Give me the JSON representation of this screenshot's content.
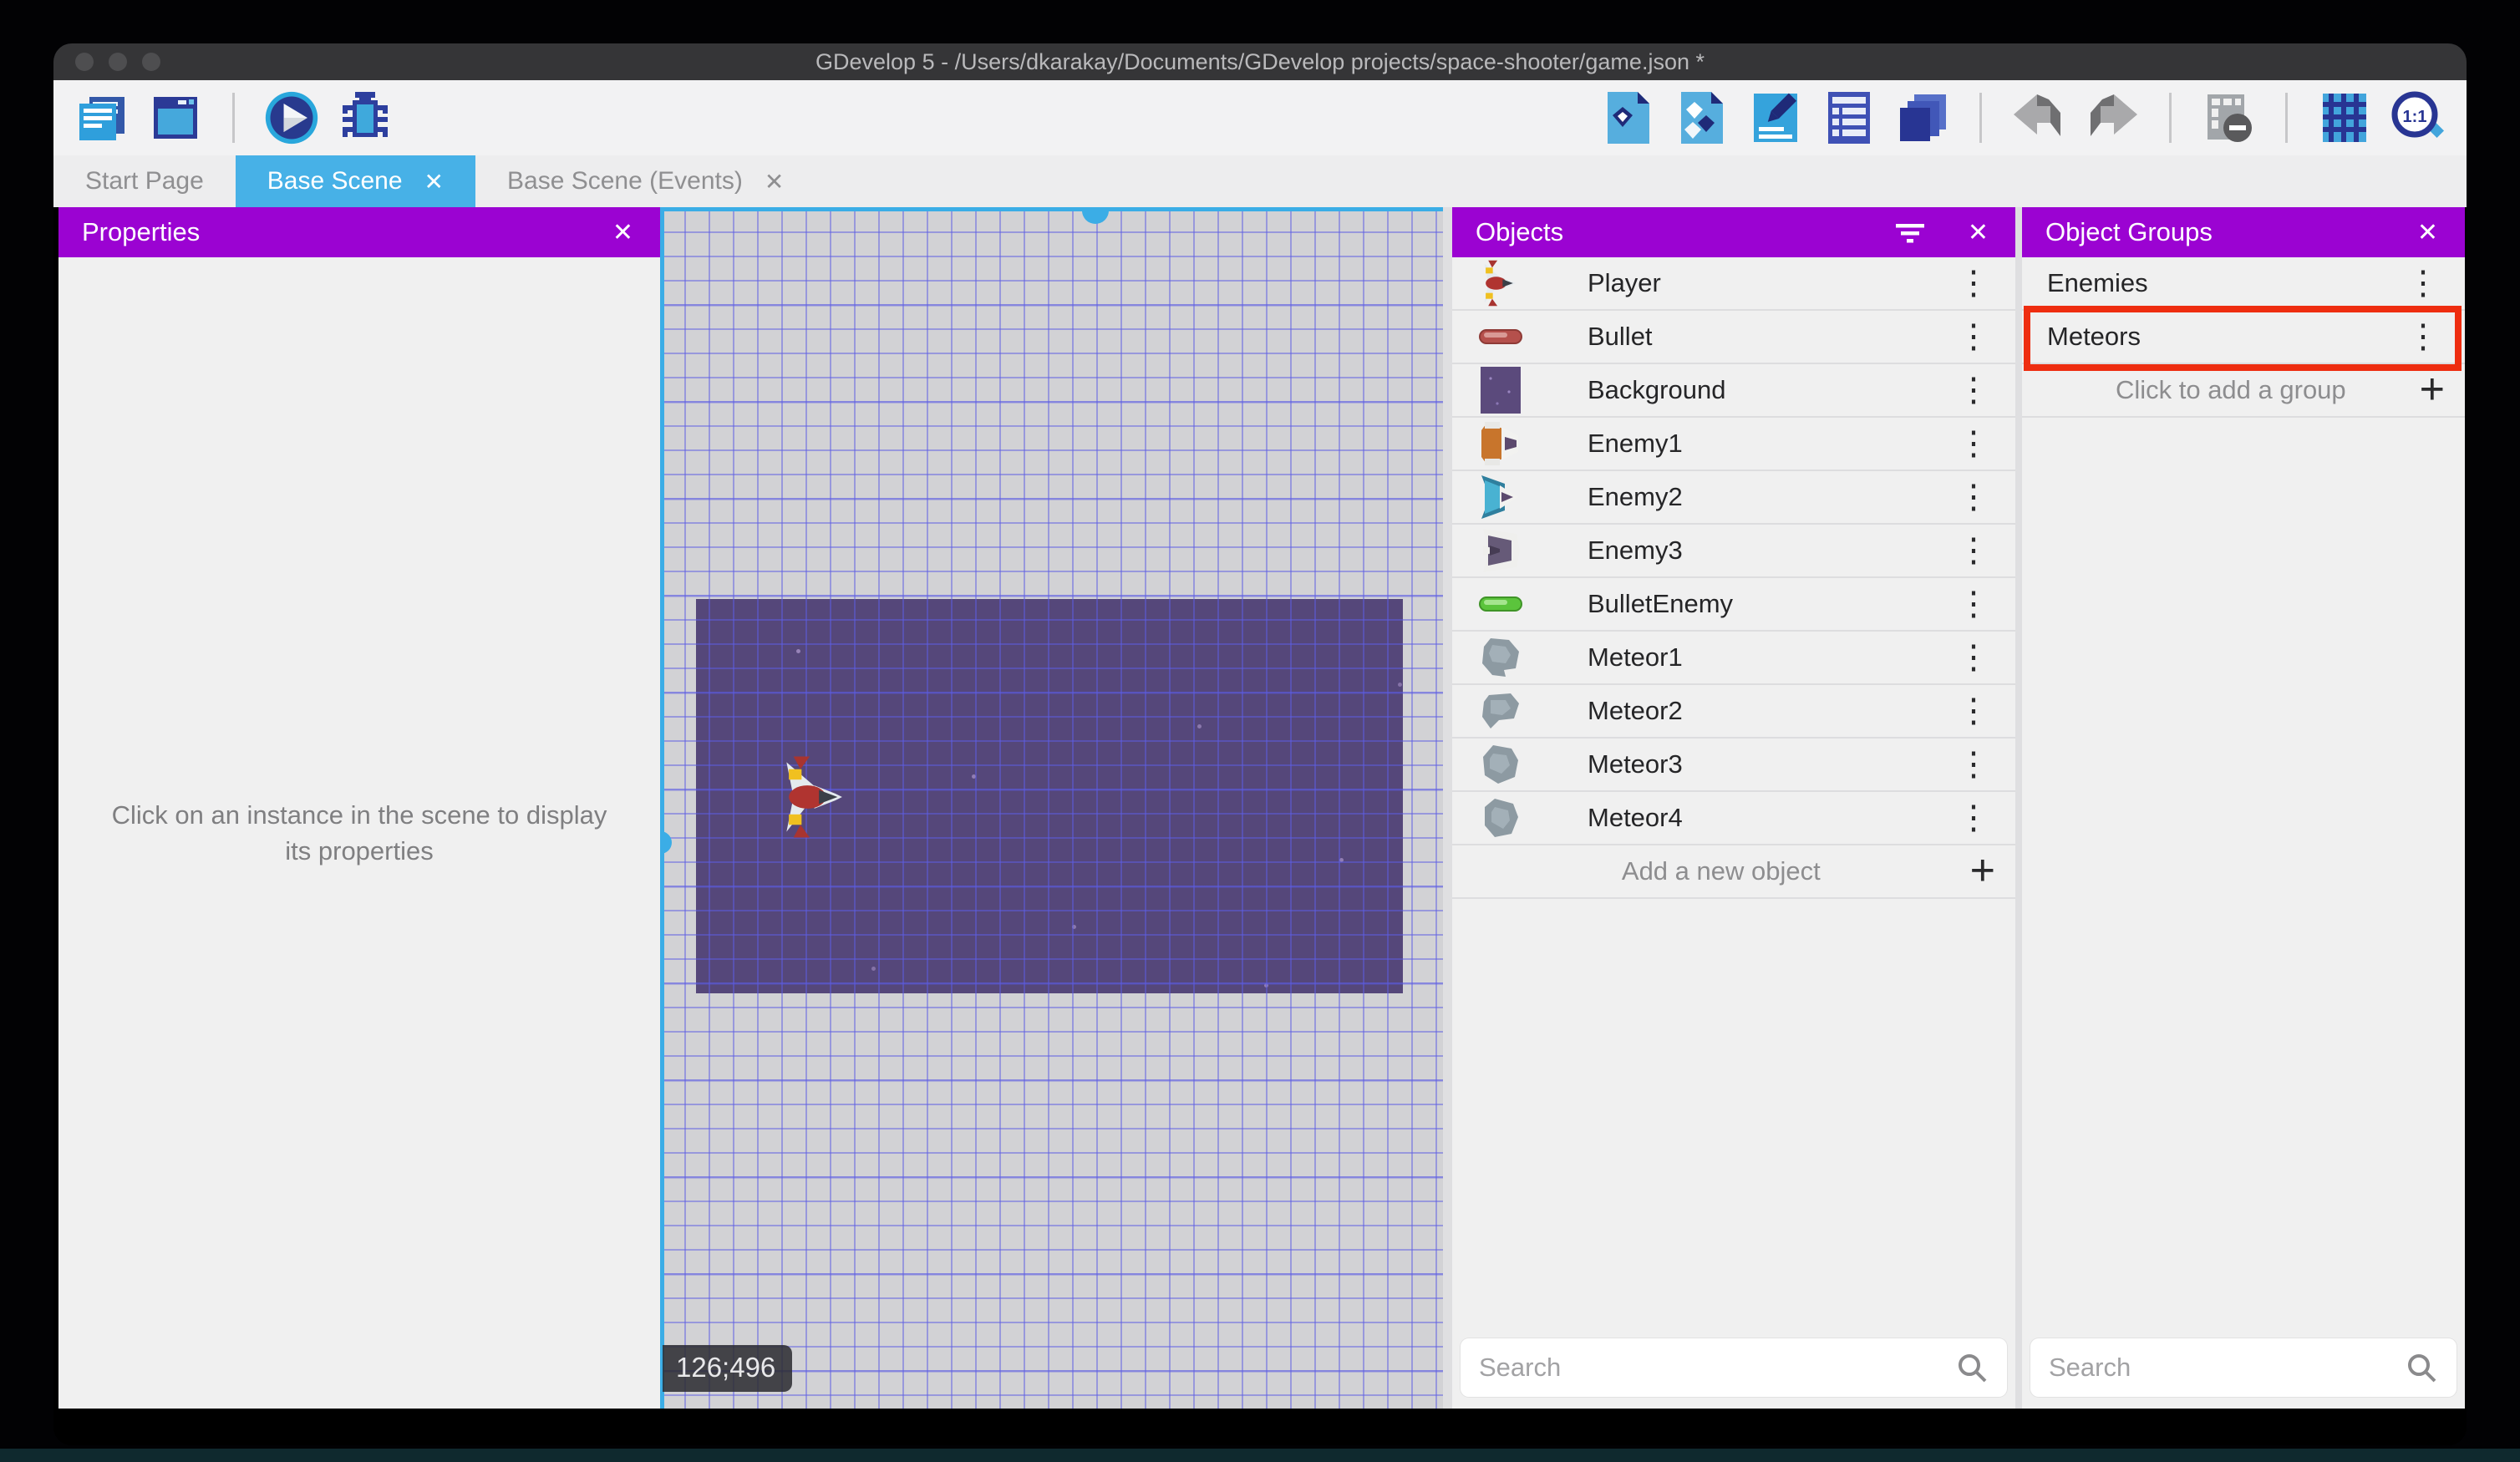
{
  "window": {
    "title": "GDevelop 5 - /Users/dkarakay/Documents/GDevelop projects/space-shooter/game.json *",
    "controls": [
      "close",
      "minimize",
      "zoom"
    ]
  },
  "toolbar": {
    "left_icons": [
      "project-manager-icon",
      "new-window-icon",
      "preview-play-icon",
      "debug-icon"
    ],
    "right_icons": [
      "export-object-icon",
      "objects-list-icon",
      "edit-scene-icon",
      "scene-properties-icon",
      "layers-icon",
      "undo-icon",
      "redo-icon",
      "toggle-mask-icon",
      "toggle-grid-icon",
      "zoom-1-1-icon"
    ]
  },
  "glyphs": {
    "close": "✕",
    "menu": "⋮",
    "plus": "+",
    "zoom_ratio": "1:1"
  },
  "tabs": [
    {
      "label": "Start Page"
    },
    {
      "label": "Base Scene"
    },
    {
      "label": "Base Scene (Events)"
    }
  ],
  "properties_panel": {
    "title": "Properties",
    "empty_message": "Click on an instance in the scene to display its properties"
  },
  "scene_canvas": {
    "coordinates": "126;496"
  },
  "objects_panel": {
    "title": "Objects",
    "items": [
      {
        "label": "Player",
        "icon": "player-ship-icon"
      },
      {
        "label": "Bullet",
        "icon": "bullet-icon"
      },
      {
        "label": "Background",
        "icon": "background-icon"
      },
      {
        "label": "Enemy1",
        "icon": "enemy1-ship-icon"
      },
      {
        "label": "Enemy2",
        "icon": "enemy2-ship-icon"
      },
      {
        "label": "Enemy3",
        "icon": "enemy3-ship-icon"
      },
      {
        "label": "BulletEnemy",
        "icon": "bullet-enemy-icon"
      },
      {
        "label": "Meteor1",
        "icon": "meteor-icon"
      },
      {
        "label": "Meteor2",
        "icon": "meteor-icon"
      },
      {
        "label": "Meteor3",
        "icon": "meteor-icon"
      },
      {
        "label": "Meteor4",
        "icon": "meteor-icon"
      }
    ],
    "add_label": "Add a new object",
    "search_placeholder": "Search"
  },
  "object_groups_panel": {
    "title": "Object Groups",
    "items": [
      {
        "label": "Enemies",
        "highlighted": false
      },
      {
        "label": "Meteors",
        "highlighted": true
      }
    ],
    "add_label": "Click to add a group",
    "search_placeholder": "Search"
  },
  "colors": {
    "header_purple": "#9b03d2",
    "tab_blue": "#47b1e7",
    "selection_blue": "#3bade6",
    "highlight_red": "#ee2d10",
    "scene_purple": "#55477a"
  }
}
